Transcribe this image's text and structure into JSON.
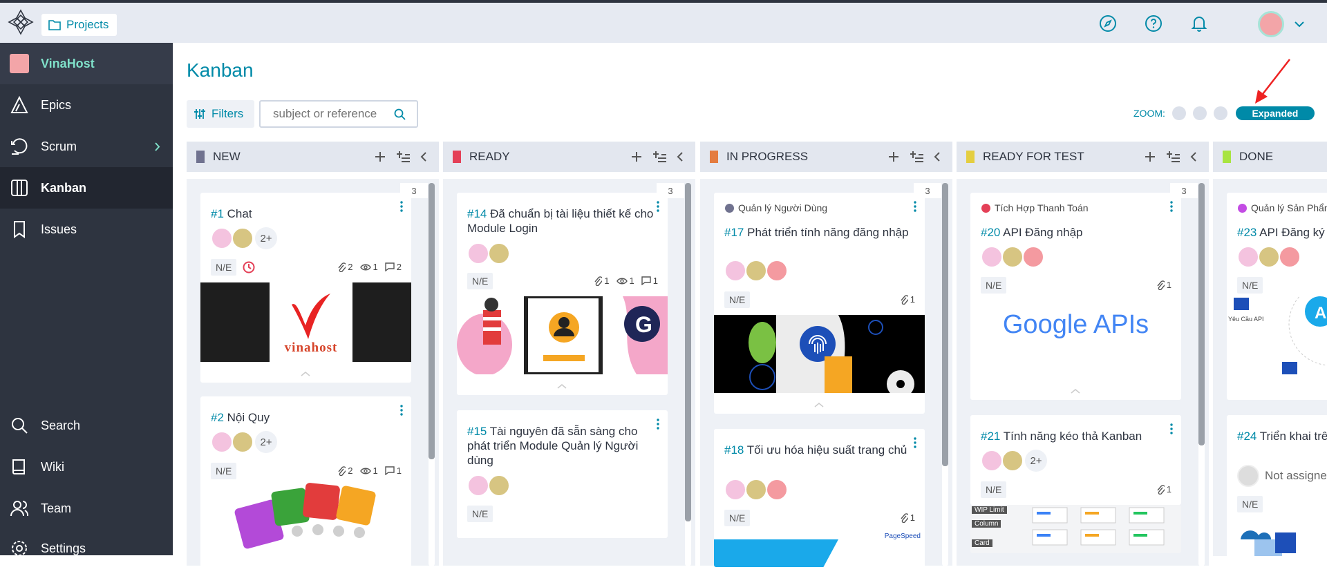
{
  "app": {
    "projects_label": "Projects"
  },
  "sidebar": {
    "project_name": "VinaHost",
    "items": [
      {
        "label": "Epics",
        "icon": "epics-icon"
      },
      {
        "label": "Scrum",
        "icon": "scrum-icon"
      },
      {
        "label": "Kanban",
        "icon": "kanban-icon"
      },
      {
        "label": "Issues",
        "icon": "issues-icon"
      },
      {
        "label": "Search",
        "icon": "search-icon"
      },
      {
        "label": "Wiki",
        "icon": "wiki-icon"
      },
      {
        "label": "Team",
        "icon": "team-icon"
      },
      {
        "label": "Settings",
        "icon": "settings-icon"
      }
    ]
  },
  "page": {
    "title": "Kanban",
    "filters_label": "Filters",
    "search_placeholder": "subject or reference",
    "zoom_label": "ZOOM:",
    "zoom_selected": "Expanded"
  },
  "columns": [
    {
      "name": "NEW",
      "color": "#70728f",
      "count": "3",
      "cards": [
        {
          "ref": "#1",
          "title": "Chat",
          "more": "2+",
          "tag": "N/E",
          "attachments": "2",
          "watchers": "1",
          "comments": "2"
        },
        {
          "ref": "#2",
          "title": "Nội Quy",
          "more": "2+",
          "tag": "N/E",
          "attachments": "2",
          "watchers": "1",
          "comments": "1"
        }
      ]
    },
    {
      "name": "READY",
      "color": "#e44057",
      "count": "3",
      "cards": [
        {
          "ref": "#14",
          "title": "Đã chuẩn bị tài liệu thiết kế cho Module Login",
          "tag": "N/E",
          "attachments": "1",
          "watchers": "1",
          "comments": "1"
        },
        {
          "ref": "#15",
          "title": "Tài nguyên đã sẵn sàng cho phát triển Module Quản lý Người dùng",
          "tag": "N/E"
        }
      ]
    },
    {
      "name": "IN PROGRESS",
      "color": "#e47c40",
      "count": "3",
      "cards": [
        {
          "epic": "Quản lý Người Dùng",
          "epic_color": "#70728f",
          "ref": "#17",
          "title": "Phát triển tính năng đăng nhập",
          "tag": "N/E",
          "attachments": "1"
        },
        {
          "ref": "#18",
          "title": "Tối ưu hóa hiệu suất trang chủ",
          "tag": "N/E",
          "attachments": "1",
          "image_text": "PageSpeed"
        }
      ]
    },
    {
      "name": "READY FOR TEST",
      "color": "#e4ce40",
      "count": "3",
      "cards": [
        {
          "epic": "Tích Hợp Thanh Toán",
          "epic_color": "#e44057",
          "ref": "#20",
          "title": "API Đăng nhập",
          "tag": "N/E",
          "attachments": "1",
          "image_text": "Google APIs"
        },
        {
          "ref": "#21",
          "title": "Tính năng kéo thả Kanban",
          "more": "2+",
          "tag": "N/E",
          "attachments": "1",
          "image_labels": [
            "WIP Limit",
            "Column",
            "Card"
          ]
        }
      ]
    },
    {
      "name": "DONE",
      "color": "#a8e440",
      "cards": [
        {
          "epic": "Quản lý Sản Phẩm",
          "epic_color": "#c34ce4",
          "ref": "#23",
          "title": "API Đăng ký",
          "tag": "N/E",
          "image_text": "Yêu Cầu API"
        },
        {
          "ref": "#24",
          "title": "Triển khai trên production",
          "unassigned": "Not assigned",
          "tag": "N/E"
        }
      ]
    }
  ],
  "chart_colors": {
    "accent": "#008aa8",
    "sidebar": "#2e3440"
  }
}
